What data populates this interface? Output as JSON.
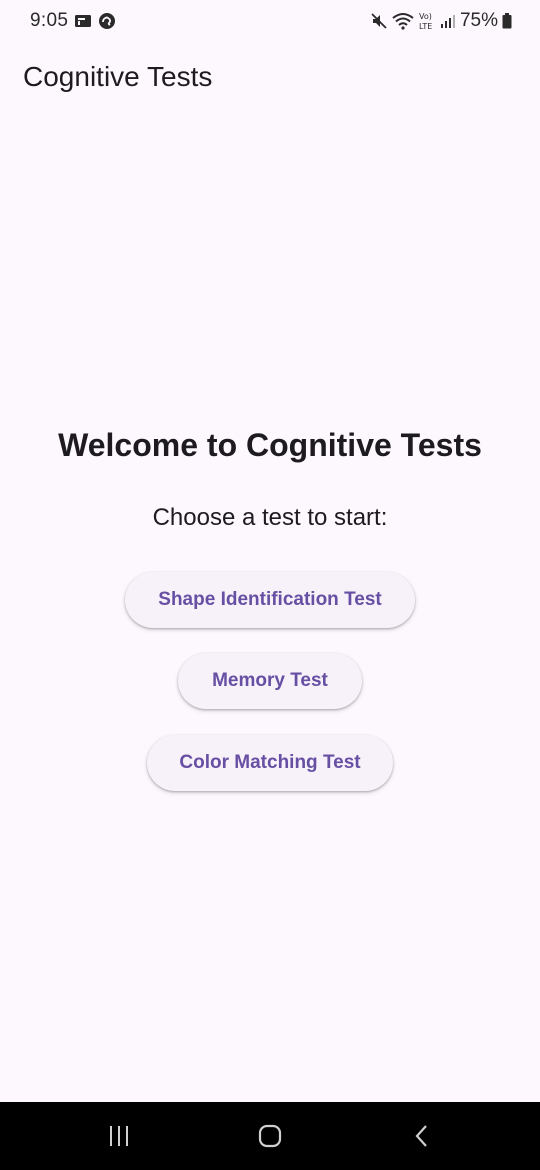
{
  "status_bar": {
    "time": "9:05",
    "battery_percent": "75%",
    "icons_left": [
      "notification-card-icon",
      "app-notification-icon"
    ],
    "icons_right": [
      "mute-icon",
      "wifi-icon",
      "volte-lte-icon",
      "signal-icon",
      "battery-icon"
    ]
  },
  "app_bar": {
    "title": "Cognitive Tests"
  },
  "main": {
    "heading": "Welcome to Cognitive Tests",
    "subtitle": "Choose a test to start:",
    "buttons": [
      {
        "label": "Shape Identification Test"
      },
      {
        "label": "Memory Test"
      },
      {
        "label": "Color Matching Test"
      }
    ]
  },
  "nav_bar": {
    "icons": [
      "recent-apps-icon",
      "home-icon",
      "back-icon"
    ]
  },
  "colors": {
    "background": "#fdf7fe",
    "button_background": "#f7f1f9",
    "button_text": "#6750a4",
    "text": "#1d1b20",
    "nav_bar": "#000000"
  }
}
